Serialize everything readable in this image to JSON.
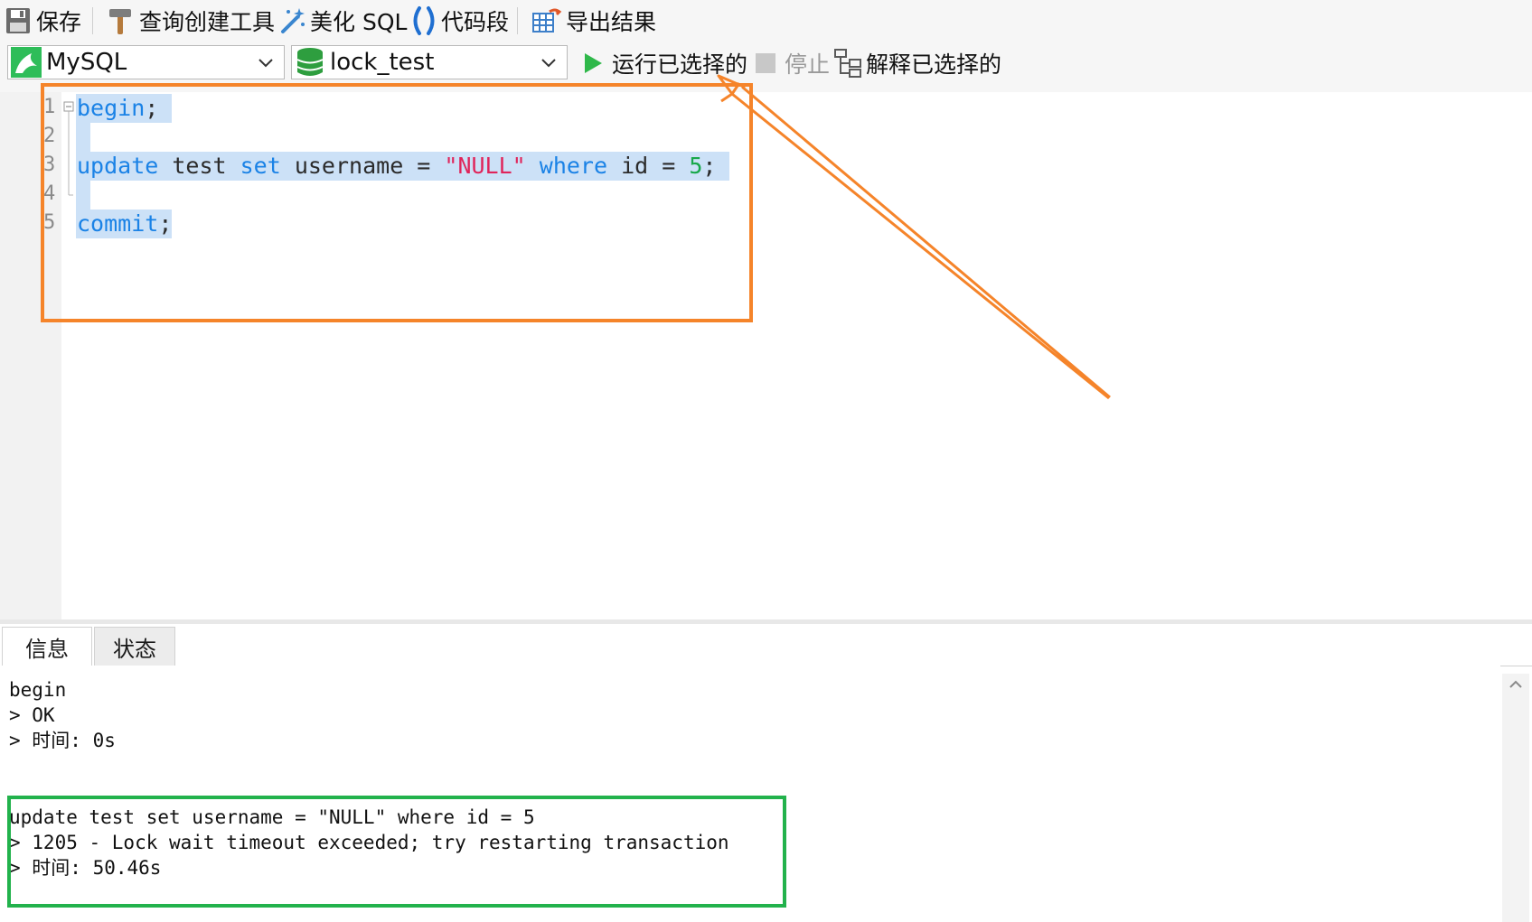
{
  "toolbar": {
    "save_label": "保存",
    "query_builder_label": "查询创建工具",
    "beautify_label": "美化 SQL",
    "snippet_label": "代码段",
    "export_label": "导出结果",
    "run_selected_label": "运行已选择的",
    "stop_label": "停止",
    "explain_selected_label": "解释已选择的"
  },
  "connection": {
    "selected": "MySQL"
  },
  "database": {
    "selected": "lock_test"
  },
  "editor": {
    "line_numbers": [
      "1",
      "2",
      "3",
      "4",
      "5"
    ],
    "line1": {
      "kw": "begin",
      "punct": ";"
    },
    "line3": {
      "kw_update": "update",
      "table": " test ",
      "kw_set": "set",
      "col": " username = ",
      "str": "\"NULL\"",
      "sp": " ",
      "kw_where": "where",
      "cond": " id = ",
      "num": "5",
      "punct": ";"
    },
    "line5": {
      "kw": "commit",
      "punct": ";"
    }
  },
  "tabs": {
    "info": "信息",
    "status": "状态"
  },
  "output": {
    "lines": [
      "begin",
      "> OK",
      "> 时间: 0s",
      "update test set username = \"NULL\" where id = 5",
      "> 1205 - Lock wait timeout exceeded; try restarting transaction",
      "> 时间: 50.46s"
    ]
  },
  "colors": {
    "annotation_orange": "#f5842a",
    "annotation_green": "#22b24c",
    "keyword_blue": "#1a82e6",
    "string_red": "#e0245a",
    "number_green": "#18a84a",
    "selection": "#cce1f7"
  }
}
